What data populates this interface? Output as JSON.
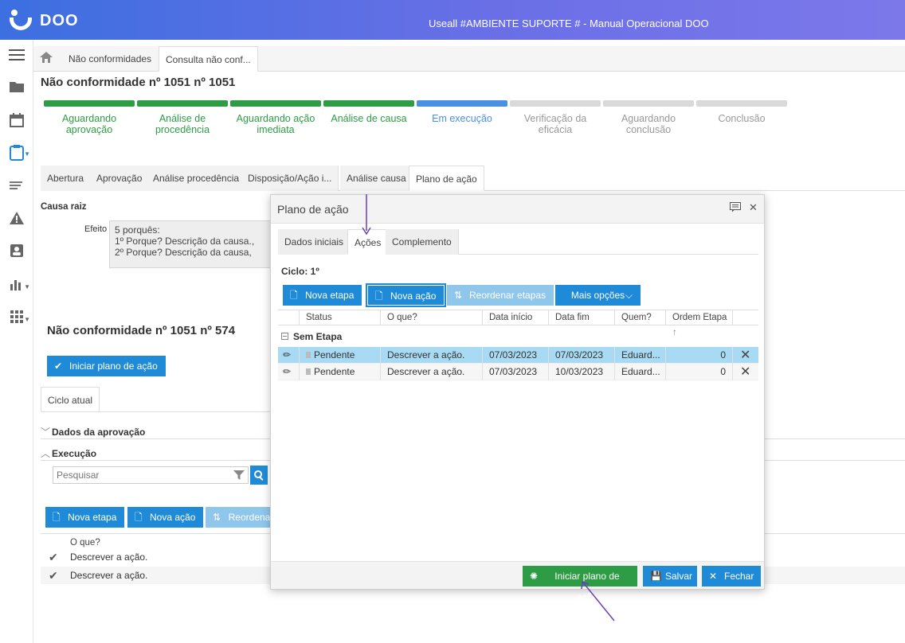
{
  "app": {
    "logo_text": "DOO",
    "title": "Useall #AMBIENTE SUPORTE # - Manual Operacional DOO"
  },
  "breadcrumb": {
    "items": [
      {
        "label": "Não conformidades"
      },
      {
        "label": "Consulta não conf..."
      }
    ]
  },
  "page": {
    "title": "Não conformidade nº 1051 nº 1051"
  },
  "stepper": {
    "steps": [
      {
        "label1": "Aguardando",
        "label2": "aprovação",
        "state": "done"
      },
      {
        "label1": "Análise de",
        "label2": "procedência",
        "state": "done"
      },
      {
        "label1": "Aguardando ação",
        "label2": "imediata",
        "state": "done"
      },
      {
        "label1": "Análise de causa",
        "label2": "",
        "state": "done"
      },
      {
        "label1": "Em execução",
        "label2": "",
        "state": "current"
      },
      {
        "label1": "Verificação da eficácia",
        "label2": "",
        "state": "todo"
      },
      {
        "label1": "Aguardando",
        "label2": "conclusão",
        "state": "todo"
      },
      {
        "label1": "Conclusão",
        "label2": "",
        "state": "todo"
      }
    ],
    "colors": {
      "done": "#2e9b45",
      "current": "#4a90e2",
      "todo": "#d9d9d9"
    }
  },
  "main_tabs": [
    {
      "label": "Abertura"
    },
    {
      "label": "Aprovação"
    },
    {
      "label": "Análise procedência"
    },
    {
      "label": "Disposição/Ação i..."
    },
    {
      "label": "Análise causa"
    },
    {
      "label": "Plano de ação"
    }
  ],
  "causa": {
    "title": "Causa raiz",
    "efeito_label": "Efeito",
    "efeito_lines": [
      "5 porquês:",
      "1º Porque? Descrição da causa.,",
      "2º Porque? Descrição da causa,"
    ]
  },
  "sub": {
    "title": "Não conformidade nº 1051 nº 574",
    "start_button": "Iniciar plano de ação",
    "cycle_tab": "Ciclo atual",
    "section_approval": "Dados da aprovação",
    "section_execution": "Execução",
    "search_placeholder": "Pesquisar",
    "btn_new_stage": "Nova etapa",
    "btn_new_action": "Nova ação",
    "btn_reorder": "Reordena",
    "list_header": "O que?",
    "rows": [
      {
        "text": "Descrever a ação."
      },
      {
        "text": "Descrever a ação."
      }
    ]
  },
  "modal": {
    "title": "Plano de ação",
    "tabs": [
      {
        "label": "Dados iniciais"
      },
      {
        "label": "Ações"
      },
      {
        "label": "Complemento"
      }
    ],
    "cycle_label": "Ciclo: 1º",
    "toolbar": {
      "new_stage": "Nova etapa",
      "new_action": "Nova ação",
      "reorder": "Reordenar etapas",
      "more": "Mais opções"
    },
    "columns": [
      "Status",
      "O que?",
      "Data início",
      "Data fim",
      "Quem?",
      "Ordem Etapa"
    ],
    "group": "Sem Etapa",
    "rows": [
      {
        "status": "Pendente",
        "what": "Descrever a ação.",
        "start": "07/03/2023",
        "end": "07/03/2023",
        "who": "Eduard...",
        "order": "0"
      },
      {
        "status": "Pendente",
        "what": "Descrever a ação.",
        "start": "07/03/2023",
        "end": "10/03/2023",
        "who": "Eduard...",
        "order": "0"
      }
    ],
    "footer": {
      "start": "Iniciar plano de ação",
      "save": "Salvar",
      "close": "Fechar"
    }
  }
}
